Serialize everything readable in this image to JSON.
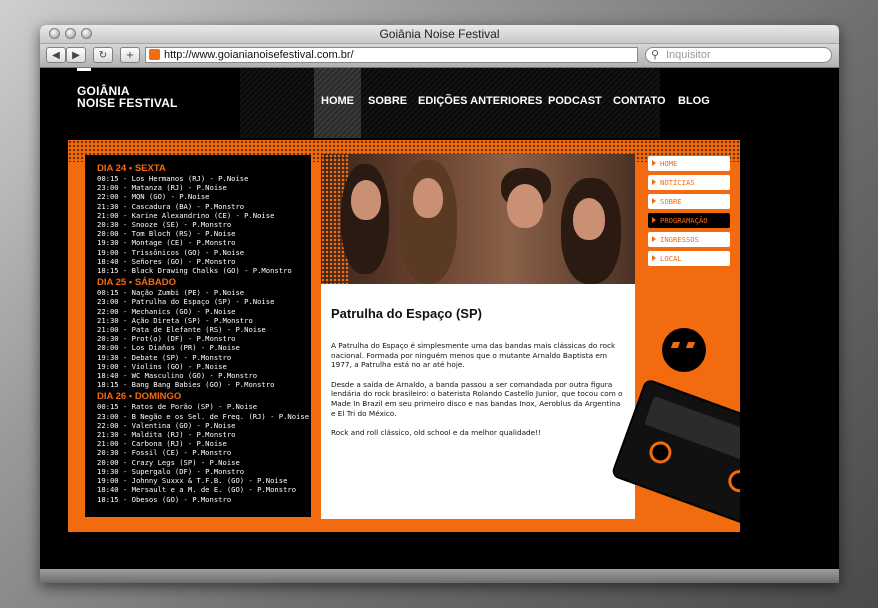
{
  "window": {
    "title": "Goiânia Noise Festival"
  },
  "toolbar": {
    "url": "http://www.goianianoisefestival.com.br/",
    "search_placeholder": "Inquisitor"
  },
  "site": {
    "logo_line1": "GOIÂNIA",
    "logo_line2": "NOISE FESTIVAL",
    "nav": [
      "HOME",
      "SOBRE",
      "EDIÇÕES ANTERIORES",
      "PODCAST",
      "CONTATO",
      "BLOG"
    ]
  },
  "schedule": [
    {
      "day": "DIA 24 • SEXTA",
      "slots": [
        "00:15 - Los Hermanos (RJ) - P.Noise",
        "23:00 - Matanza (RJ) - P.Noise",
        "22:00 - MQN (GO) - P.Noise",
        "21:30 - Cascadura (BA) - P.Monstro",
        "21:00 - Karine Alexandrino (CE) - P.Noise",
        "20:30 - Snooze (SE) - P.Monstro",
        "20:00 - Tom Bloch (RS) - P.Noise",
        "19:30 - Montage (CE) - P.Monstro",
        "19:00 - Trissônicos (GO) - P.Noise",
        "18:40 - Señores (GO) - P.Monstro",
        "18:15 - Black Drawing Chalks (GO) - P.Monstro"
      ]
    },
    {
      "day": "DIA 25 • SÁBADO",
      "slots": [
        "00:15 - Nação Zumbi (PE) - P.Noise",
        "23:00 - Patrulha do Espaço (SP) - P.Noise",
        "22:00 - Mechanics (GO) - P.Noise",
        "21:30 - Ação Direta (SP) - P.Monstro",
        "21:00 - Pata de Elefante (RS) - P.Noise",
        "20:30 - Prot(o) (DF) - P.Monstro",
        "20:00 - Los Diaños (PR) - P.Noise",
        "19:30 - Debate (SP) - P.Monstro",
        "19:00 - Violins (GO) - P.Noise",
        "18:40 - WC Masculino (GO) - P.Monstro",
        "18:15 - Bang Bang Babies (GO) - P.Monstro"
      ]
    },
    {
      "day": "DIA 26 • DOMINGO",
      "slots": [
        "00:15 - Ratos de Porão (SP) - P.Noise",
        "23:00 - B Negão e os Sel. de Freq. (RJ) - P.Noise",
        "22:00 - Valentina (GO) - P.Noise",
        "21:30 - Maldita (RJ) - P.Monstro",
        "21:00 - Carbona (RJ) - P.Noise",
        "20:30 - Fossil (CE) - P.Monstro",
        "20:00 - Crazy Legs (SP) - P.Noise",
        "19:30 - Supergalo (DF) - P.Monstro",
        "19:00 - Johnny Suxxx & T.F.B. (GO) - P.Noise",
        "18:40 - Mersault e a M. de E. (GO) - P.Monstro",
        "18:15 - Obesos (GO) - P.Monstro"
      ]
    }
  ],
  "article": {
    "title": "Patrulha do Espaço (SP)",
    "p1": "A Patrulha do Espaço é simplesmente uma das bandas mais clássicas do rock nacional. Formada por ninguém menos que o mutante Arnaldo Baptista em 1977, a Patrulha está no ar até hoje.",
    "p2": "Desde a saída de Arnaldo, a banda passou a ser comandada por outra figura lendária do rock brasileiro: o baterista Rolando Castello Junior, que tocou com o Made In Brazil em seu primeiro disco e nas bandas Inox, Aeroblus da Argentina e El Tri do México.",
    "p3": "Rock and roll clássico, old school e da melhor qualidade!!"
  },
  "sidemenu": [
    {
      "label": "HOME",
      "active": false
    },
    {
      "label": "NOTÍCIAS",
      "active": false
    },
    {
      "label": "SOBRE",
      "active": false
    },
    {
      "label": "PROGRAMAÇÃO",
      "active": true
    },
    {
      "label": "INGRESSOS",
      "active": false
    },
    {
      "label": "LOCAL",
      "active": false
    }
  ],
  "colors": {
    "accent": "#f26b0f",
    "background": "#000000"
  }
}
